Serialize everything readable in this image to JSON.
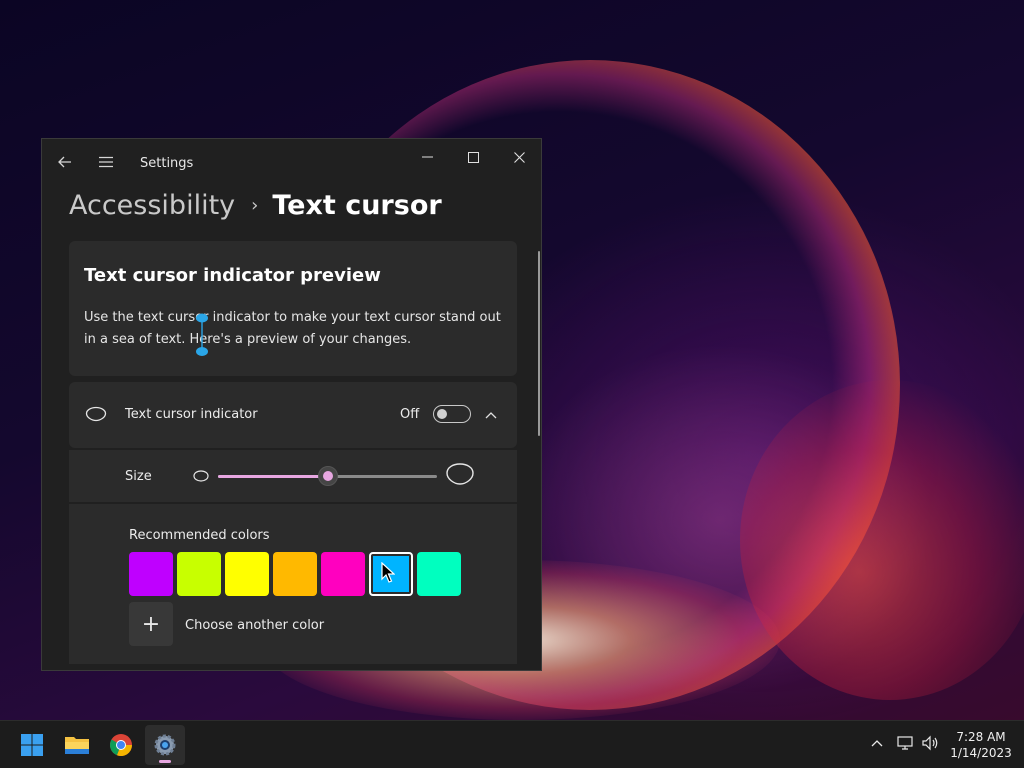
{
  "window": {
    "app_title": "Settings",
    "controls": {
      "minimize": "minimize-icon",
      "maximize": "maximize-icon",
      "close": "close-icon"
    }
  },
  "breadcrumb": {
    "parent": "Accessibility",
    "separator": "›",
    "current": "Text cursor"
  },
  "preview": {
    "title": "Text cursor indicator preview",
    "description": "Use the text cursor indicator to make your text cursor stand out in a sea of text. Here's a preview of your changes."
  },
  "indicator": {
    "label": "Text cursor indicator",
    "state_label": "Off",
    "enabled": false
  },
  "size": {
    "label": "Size",
    "level": 0.5
  },
  "colors": {
    "label": "Recommended colors",
    "swatches": [
      "#bf00ff",
      "#c8ff00",
      "#ffff00",
      "#ffb900",
      "#ff00bf",
      "#00b4ff",
      "#00ffbf"
    ],
    "selected_index": 5,
    "accent": "#e7a7e1",
    "add_label": "Choose another color",
    "add_symbol": "+"
  },
  "taskbar": {
    "apps": [
      "windows-start-icon",
      "file-explorer-icon",
      "chrome-icon",
      "settings-icon"
    ],
    "active_app": "settings-icon",
    "time": "7:28 AM",
    "date": "1/14/2023"
  }
}
